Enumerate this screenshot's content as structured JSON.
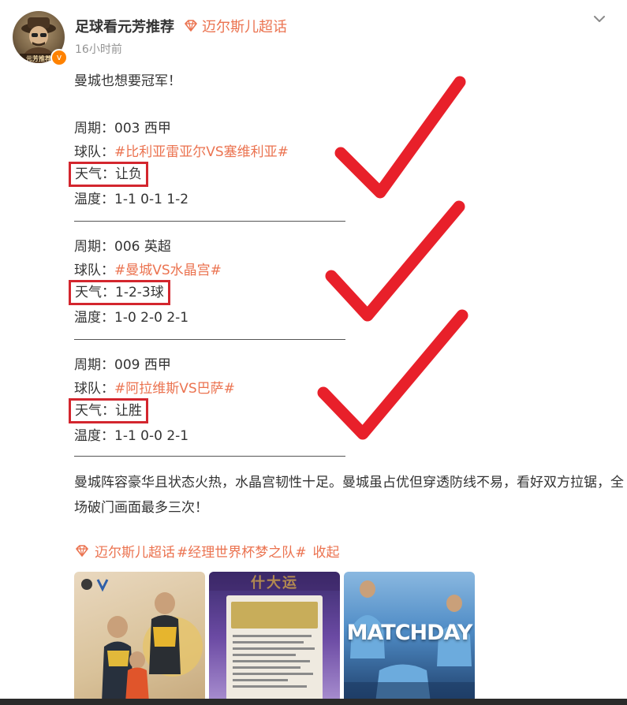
{
  "post": {
    "author": "足球看元芳推荐",
    "super_topic": "迈尔斯儿超话",
    "time": "16小时前",
    "verified_mark": "v",
    "avatar_text": "元芳推荐",
    "intro": "曼城也想要冠军！",
    "matches": [
      {
        "period": "周期：003 西甲",
        "team_label": "球队：",
        "team_tag": "#比利亚雷亚尔VS塞维利亚#",
        "weather": "天气：让负",
        "temp": "温度：1-1 0-1 1-2"
      },
      {
        "period": "周期：006 英超",
        "team_label": "球队：",
        "team_tag": "#曼城VS水晶宫#",
        "weather": "天气：1-2-3球",
        "temp": "温度：1-0 2-0 2-1"
      },
      {
        "period": "周期：009 西甲",
        "team_label": "球队：",
        "team_tag": "#阿拉维斯VS巴萨#",
        "weather": "天气：让胜",
        "temp": "温度：1-1 0-0 2-1"
      }
    ],
    "body": "曼城阵容豪华且状态火热，水晶宫韧性十足。曼城虽占优但穿透防线不易，看好双方拉锯，全场破门画面最多三次！",
    "topics": {
      "super_topic": "迈尔斯儿超话",
      "hashtag": "#经理世界杯梦之队#",
      "collapse": "收起"
    },
    "images": [
      {
        "icon": "football-players-photo"
      },
      {
        "banner": "什大运",
        "icon": "lottery-ticket-photo"
      },
      {
        "overlay": "MATCHDAY",
        "icon": "team-celebration-photo"
      }
    ]
  },
  "colors": {
    "accent": "#eb7350",
    "highlight_box": "#d3262e",
    "check": "#e8202a",
    "text": "#333333",
    "muted": "#939393",
    "verified": "#ff8200"
  }
}
